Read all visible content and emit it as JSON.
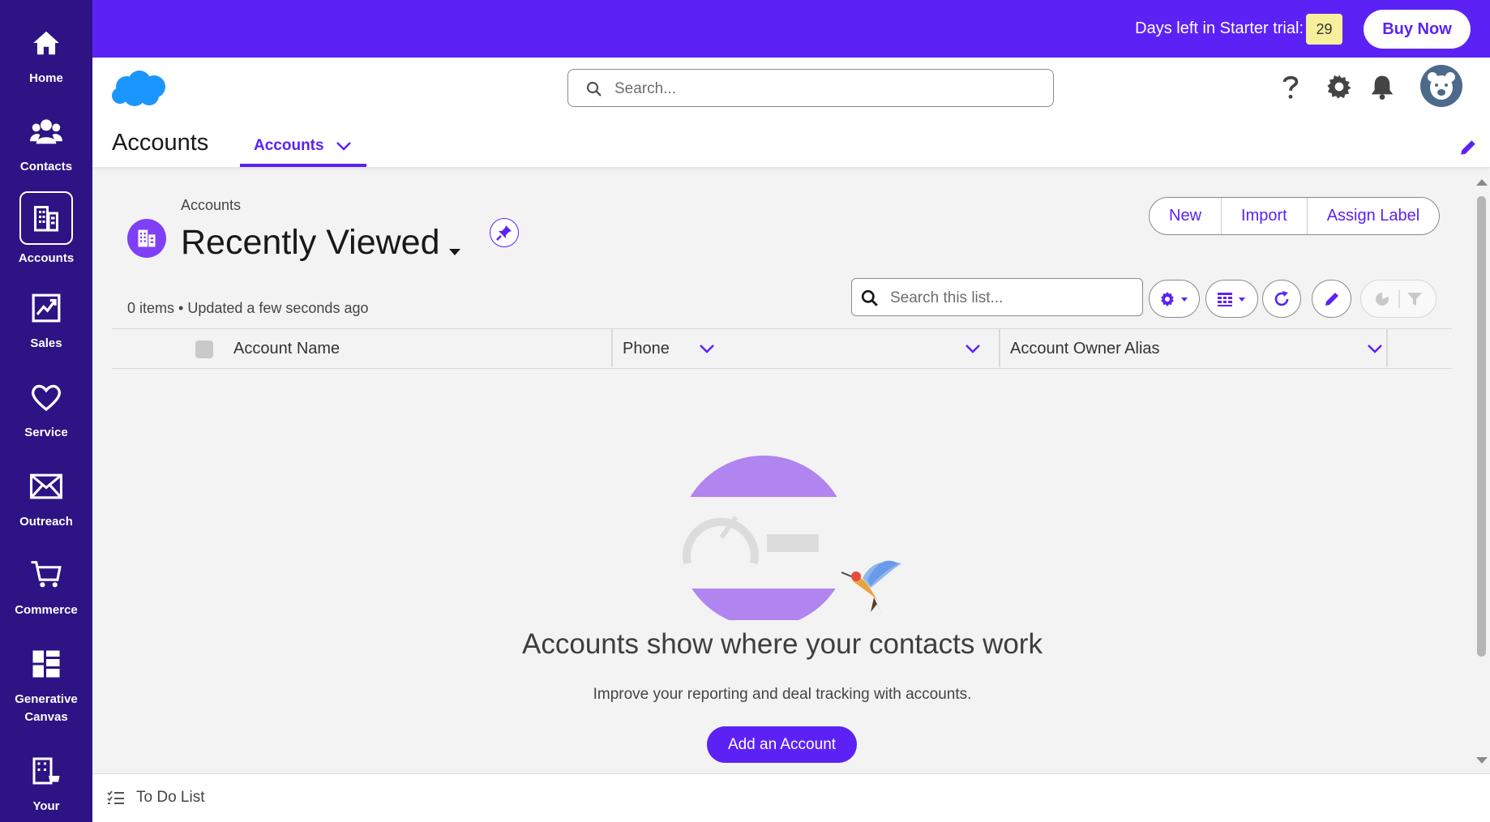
{
  "colors": {
    "nav_bg": "#2e1384",
    "accent": "#5c22f5",
    "trial_badge": "#f6ef9b",
    "object_icon": "#7f3ff5"
  },
  "leftnav": {
    "items": [
      {
        "label": "Home",
        "icon": "home-icon"
      },
      {
        "label": "Contacts",
        "icon": "contacts-icon"
      },
      {
        "label": "Accounts",
        "icon": "building-icon",
        "active": true
      },
      {
        "label": "Sales",
        "icon": "chart-icon"
      },
      {
        "label": "Service",
        "icon": "heart-icon"
      },
      {
        "label": "Outreach",
        "icon": "envelope-icon"
      },
      {
        "label": "Commerce",
        "icon": "cart-icon"
      },
      {
        "label": "Generative Canvas",
        "icon": "canvas-icon"
      },
      {
        "label": "Your",
        "icon": "store-icon"
      }
    ]
  },
  "trial": {
    "text": "Days left in Starter trial:",
    "days": "29",
    "buy_label": "Buy Now"
  },
  "header": {
    "search_placeholder": "Search...",
    "icons": [
      "help-icon",
      "gear-icon",
      "bell-icon",
      "avatar"
    ]
  },
  "nav": {
    "app_title": "Accounts",
    "tab_label": "Accounts"
  },
  "list": {
    "breadcrumb": "Accounts",
    "title": "Recently Viewed",
    "meta": "0 items • Updated a few seconds ago",
    "search_placeholder": "Search this list...",
    "actions": [
      "New",
      "Import",
      "Assign Label"
    ],
    "columns": [
      "Account Name",
      "Phone",
      "Account Owner Alias"
    ]
  },
  "empty_state": {
    "title": "Accounts show where your contacts work",
    "subtitle": "Improve your reporting and deal tracking with accounts.",
    "button": "Add an Account"
  },
  "utility": {
    "todo_label": "To Do List"
  }
}
